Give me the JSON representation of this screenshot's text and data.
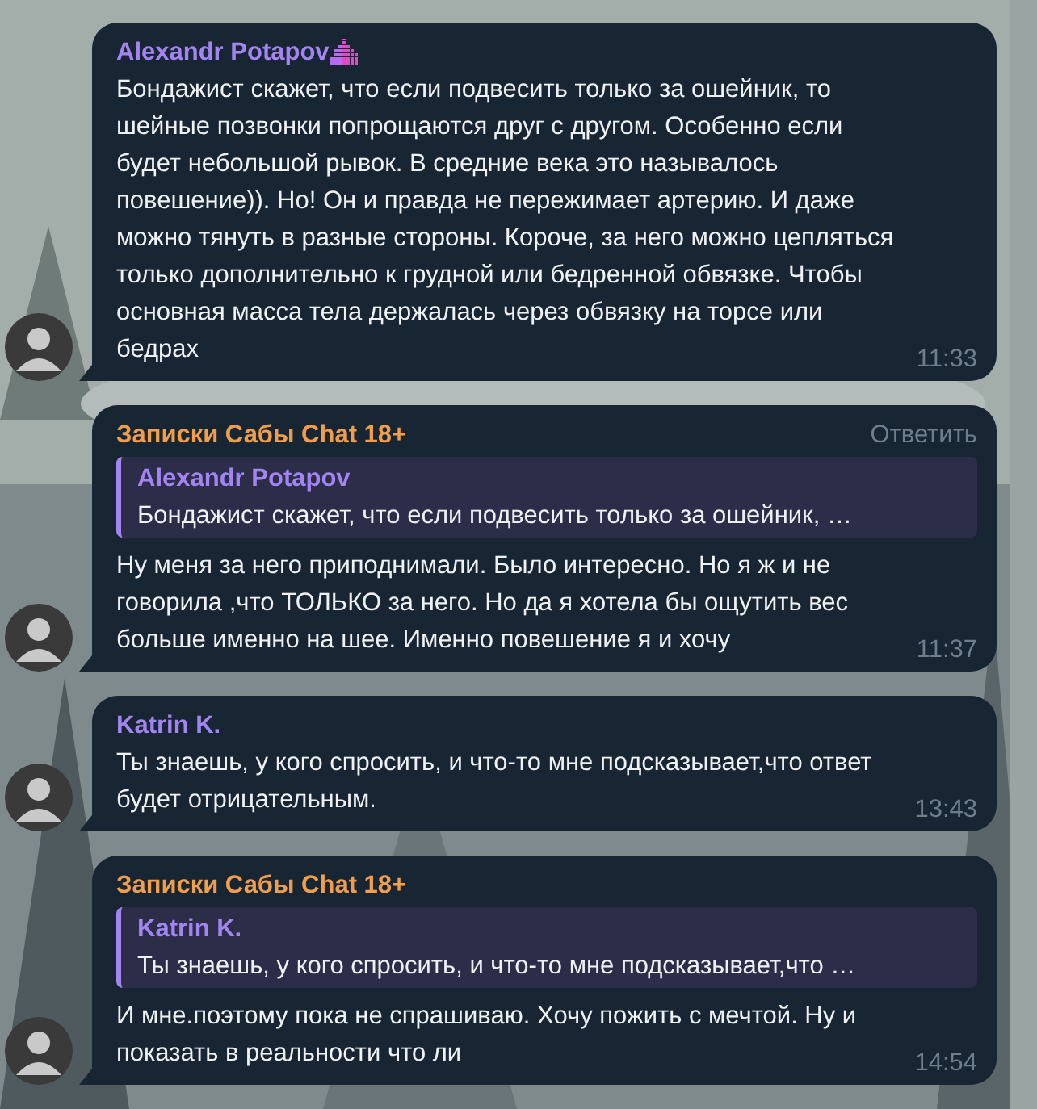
{
  "messages": [
    {
      "author": "Alexandr Potapov",
      "color": "#a385f2",
      "badge": true,
      "text": "Бондажист скажет, что если подвесить только за ошейник, то шейные позвонки попрощаются друг с другом. Особенно если будет небольшой рывок. В средние века это называлось повешение)). Но! Он и правда не пережимает артерию. И даже можно тянуть в разные стороны. Короче, за него можно цепляться только дополнительно к грудной или бедренной обвязке. Чтобы основная масса тела держалась через обвязку на торсе или бедрах",
      "time": "11:33"
    },
    {
      "author": "Записки Сабы Chat 18+",
      "color": "#f09e4c",
      "badge": false,
      "reply_action": "Ответить",
      "quote": {
        "author": "Alexandr Potapov",
        "text": "Бондажист скажет, что если подвесить только за ошейник, …"
      },
      "text": "Ну меня за него приподнимали. Было интересно. Но я ж и не говорила ,что ТОЛЬКО за него. Но да  я хотела бы ощутить вес больше именно на шее. Именно повешение я и хочу",
      "time": "11:37"
    },
    {
      "author": "Katrin K.",
      "color": "#a385f2",
      "badge": false,
      "text": "Ты знаешь, у кого спросить, и что-то мне подсказывает,что ответ будет отрицательным.",
      "time": "13:43"
    },
    {
      "author": "Записки Сабы Chat 18+",
      "color": "#f09e4c",
      "badge": false,
      "quote": {
        "author": "Katrin K.",
        "text": "Ты знаешь, у кого спросить, и что-то мне подсказывает,что …"
      },
      "text": "И мне.поэтому пока не спрашиваю. Хочу пожить с мечтой. Ну и показать в реальности что ли",
      "time": "14:54"
    }
  ]
}
